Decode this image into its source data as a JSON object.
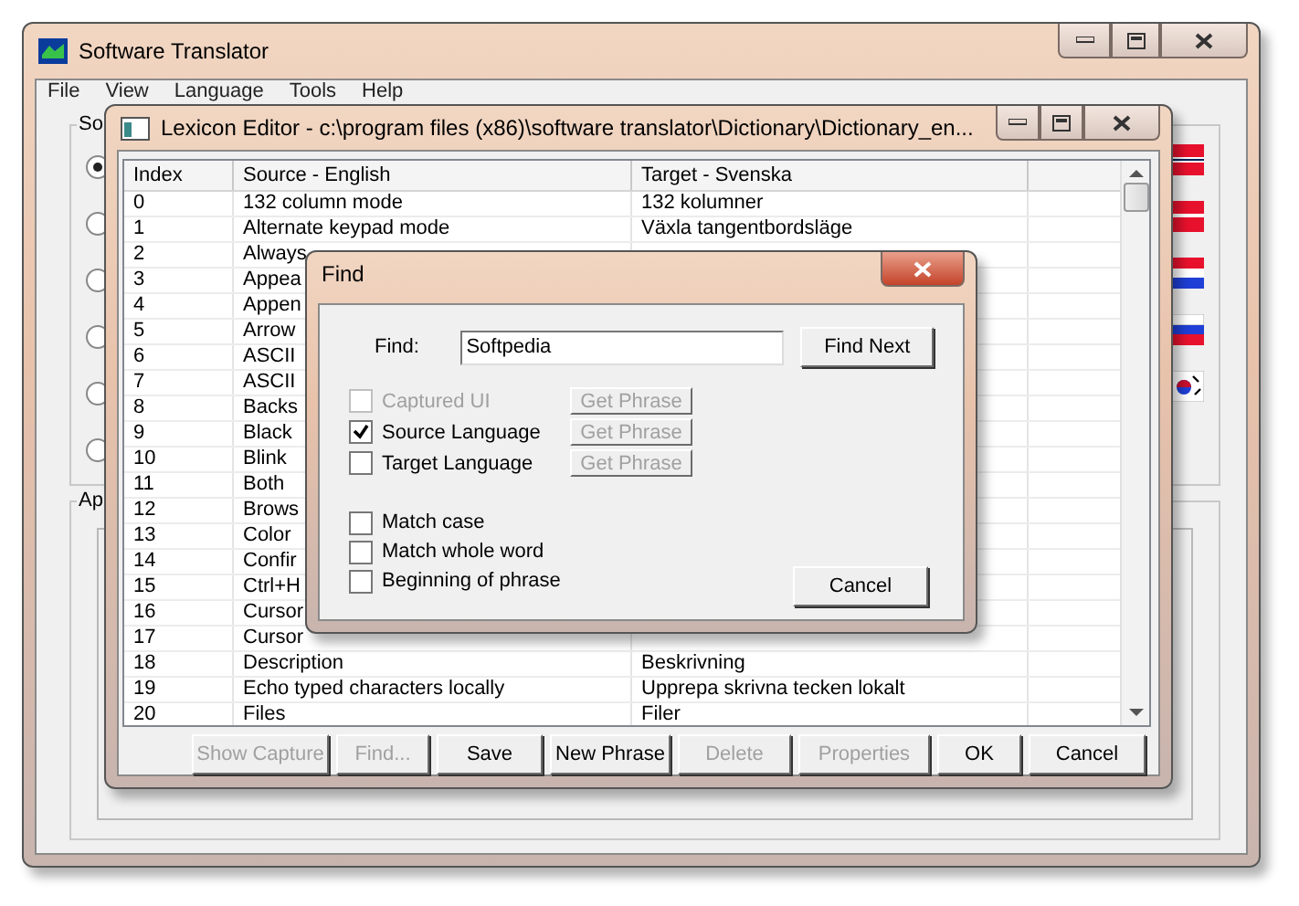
{
  "main_window": {
    "title": "Software Translator",
    "menu": [
      "File",
      "View",
      "Language",
      "Tools",
      "Help"
    ],
    "source_group": {
      "label": "So",
      "options": [
        {
          "selected": true
        },
        {
          "selected": false
        },
        {
          "selected": false
        },
        {
          "selected": false
        },
        {
          "selected": false
        },
        {
          "selected": false
        }
      ],
      "flags": [
        {
          "kind": "norway"
        },
        {
          "kind": "denmark"
        },
        {
          "kind": "croatia"
        },
        {
          "kind": "russia"
        },
        {
          "kind": "korea"
        }
      ]
    },
    "app_group": {
      "label": "Ap"
    }
  },
  "lexicon_editor": {
    "title": "Lexicon Editor - c:\\program files (x86)\\software translator\\Dictionary\\Dictionary_en...",
    "columns": [
      "Index",
      "Source - English",
      "Target - Svenska"
    ],
    "rows": [
      {
        "index": "0",
        "source": "132 column mode",
        "target": "132 kolumner"
      },
      {
        "index": "1",
        "source": "Alternate keypad mode",
        "target": "Växla tangentbordsläge"
      },
      {
        "index": "2",
        "source": "Always"
      },
      {
        "index": "3",
        "source": "Appea"
      },
      {
        "index": "4",
        "source": "Appen"
      },
      {
        "index": "5",
        "source": "Arrow"
      },
      {
        "index": "6",
        "source": "ASCII"
      },
      {
        "index": "7",
        "source": "ASCII"
      },
      {
        "index": "8",
        "source": "Backs"
      },
      {
        "index": "9",
        "source": "Black"
      },
      {
        "index": "10",
        "source": "Blink"
      },
      {
        "index": "11",
        "source": "Both"
      },
      {
        "index": "12",
        "source": "Brows"
      },
      {
        "index": "13",
        "source": "Color"
      },
      {
        "index": "14",
        "source": "Confir"
      },
      {
        "index": "15",
        "source": "Ctrl+H"
      },
      {
        "index": "16",
        "source": "Cursor"
      },
      {
        "index": "17",
        "source": "Cursor"
      },
      {
        "index": "18",
        "source": "Description",
        "target": "Beskrivning"
      },
      {
        "index": "19",
        "source": "Echo typed characters locally",
        "target": "Upprepa skrivna tecken lokalt"
      },
      {
        "index": "20",
        "source": "Files",
        "target": "Filer"
      }
    ],
    "buttons": [
      {
        "label": "Show Capture",
        "disabled": true
      },
      {
        "label": "Find...",
        "disabled": true
      },
      {
        "label": "Save",
        "disabled": false
      },
      {
        "label": "New Phrase",
        "disabled": false
      },
      {
        "label": "Delete",
        "disabled": true
      },
      {
        "label": "Properties",
        "disabled": true
      },
      {
        "label": "OK",
        "disabled": false
      },
      {
        "label": "Cancel",
        "disabled": false
      }
    ]
  },
  "find_dialog": {
    "title": "Find",
    "find_label": "Find:",
    "find_value": "Softpedia",
    "find_next": "Find Next",
    "scopes": [
      {
        "label": "Captured UI",
        "checked": false,
        "disabled": true,
        "button": "Get Phrase",
        "button_disabled": true
      },
      {
        "label": "Source Language",
        "checked": true,
        "disabled": false,
        "button": "Get Phrase",
        "button_disabled": true
      },
      {
        "label": "Target Language",
        "checked": false,
        "disabled": false,
        "button": "Get Phrase",
        "button_disabled": true
      }
    ],
    "options": [
      {
        "label": "Match case",
        "checked": false
      },
      {
        "label": "Match whole word",
        "checked": false
      },
      {
        "label": "Beginning of phrase",
        "checked": false
      }
    ],
    "cancel": "Cancel"
  }
}
